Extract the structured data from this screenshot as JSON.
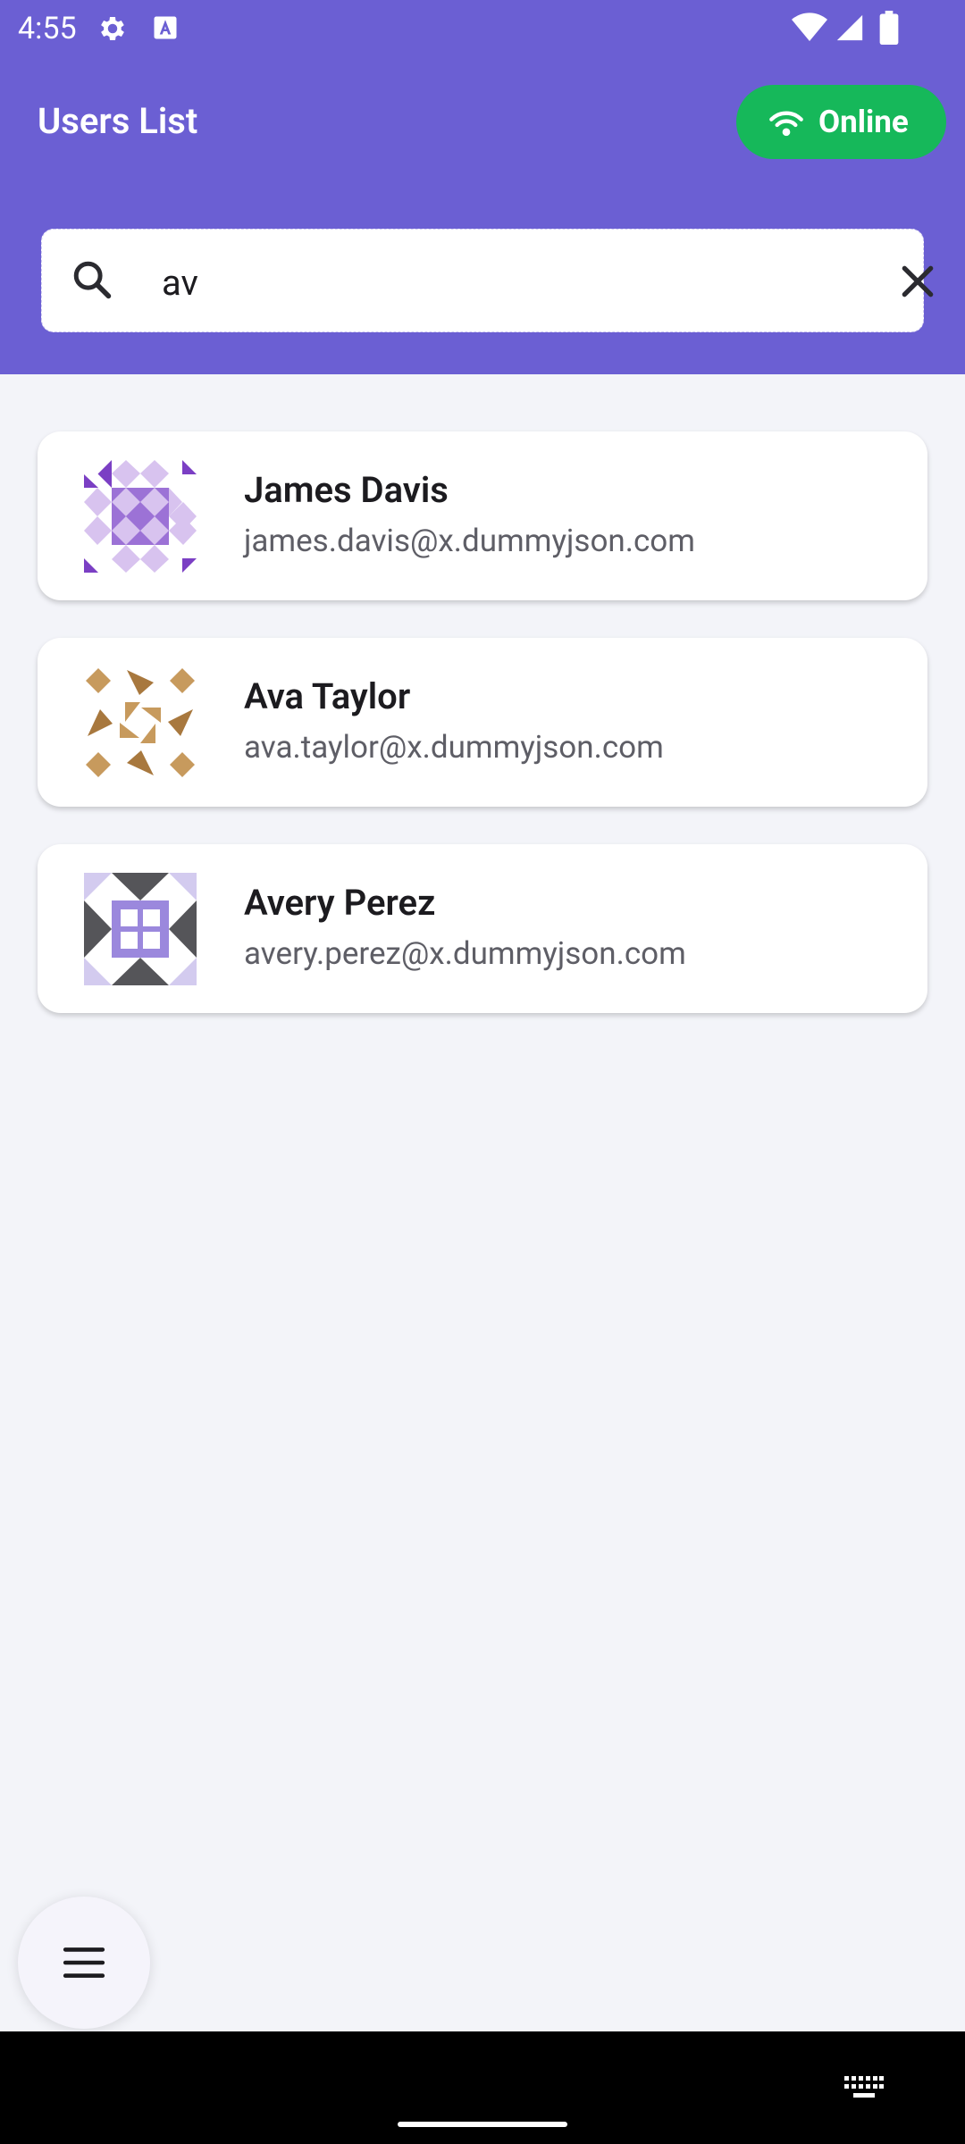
{
  "status_bar": {
    "time": "4:55",
    "icons": [
      "settings-gear-icon",
      "font-a-icon",
      "wifi-icon",
      "cell-signal-icon",
      "battery-icon"
    ]
  },
  "header": {
    "title": "Users List",
    "online_label": "Online",
    "online_color": "#16b85a",
    "background": "#6b5fd3"
  },
  "search": {
    "value": "av",
    "placeholder": ""
  },
  "users": [
    {
      "name": "James Davis",
      "email": "james.davis@x.dummyjson.com"
    },
    {
      "name": "Ava Taylor",
      "email": "ava.taylor@x.dummyjson.com"
    },
    {
      "name": "Avery Perez",
      "email": "avery.perez@x.dummyjson.com"
    }
  ],
  "fab": {
    "icon": "menu-icon"
  },
  "nav_bar": {
    "icon": "keyboard-icon"
  }
}
